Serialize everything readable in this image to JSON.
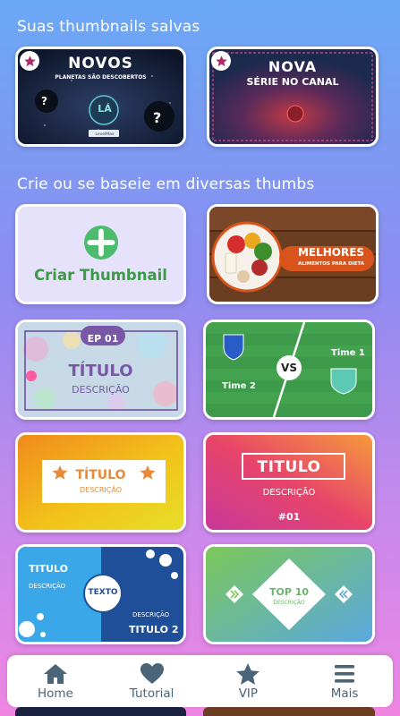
{
  "saved_section": {
    "title": "Suas thumbnails salvas",
    "items": [
      {
        "headline": "NOVOS",
        "subline": "PLANETAS SÃO DESCOBERTOS",
        "logo": "LÁ",
        "logo_caption": "LevelMax",
        "badge_icon": "star-icon"
      },
      {
        "headline": "NOVA",
        "subline": "SÉRIE NO CANAL",
        "badge_icon": "star-icon"
      }
    ]
  },
  "templates_section": {
    "title": "Crie ou se baseie em diversas thumbs",
    "create_label": "Criar Thumbnail",
    "templates": [
      {
        "title": "MELHORES",
        "subtitle": "ALIMENTOS PARA DIETA"
      },
      {
        "badge": "EP 01",
        "title": "TÍTULO",
        "subtitle": "DESCRIÇÃO"
      },
      {
        "team1": "Time 2",
        "vs": "VS",
        "team2": "Time 1"
      },
      {
        "title": "TÍTULO",
        "subtitle": "DESCRIÇÃO"
      },
      {
        "title": "TITULO",
        "subtitle": "DESCRIÇÃO",
        "number": "#01"
      },
      {
        "title": "TITULO",
        "desc_left": "DESCRIÇÃO",
        "center": "TEXTO",
        "desc_right": "DESCRIÇÃO",
        "title2": "TITULO 2"
      },
      {
        "title": "TOP 10",
        "subtitle": "DESCRIÇÃO"
      }
    ]
  },
  "bottom_nav": [
    {
      "label": "Home",
      "icon": "home-icon"
    },
    {
      "label": "Tutorial",
      "icon": "heart-icon"
    },
    {
      "label": "VIP",
      "icon": "star-icon"
    },
    {
      "label": "Mais",
      "icon": "menu-icon"
    }
  ],
  "colors": {
    "accent_green": "#4bbb6c",
    "create_text": "#3d9a46",
    "nav_icon": "#4a6577",
    "badge_star": "#b0286a"
  }
}
